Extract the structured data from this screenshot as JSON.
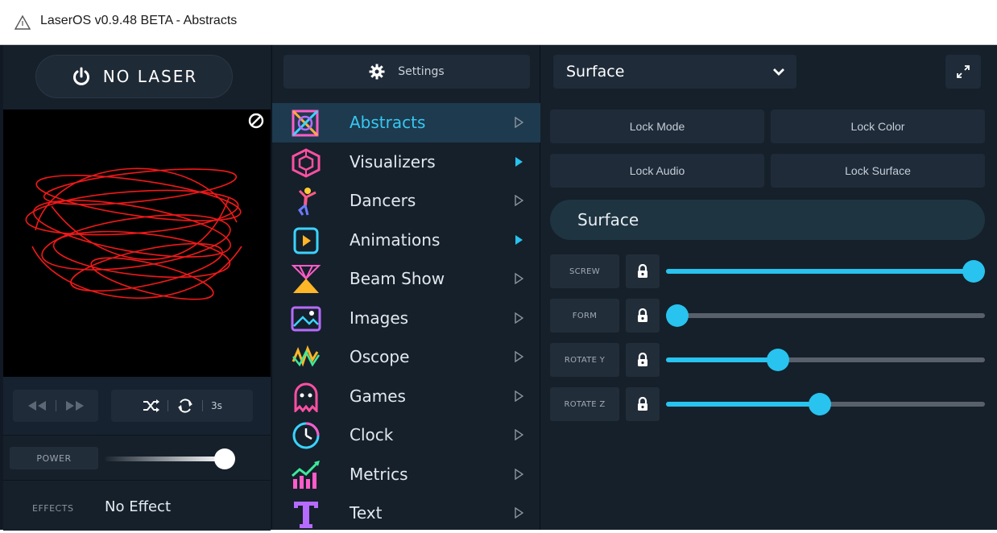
{
  "window": {
    "title": "LaserOS v0.9.48 BETA - Abstracts"
  },
  "left": {
    "no_laser_label": "NO LASER",
    "transport": {
      "interval": "3s"
    },
    "power": {
      "label": "POWER",
      "value": 1.0
    },
    "effects": {
      "label": "EFFECTS",
      "value": "No Effect"
    }
  },
  "middle": {
    "settings_label": "Settings",
    "items": [
      {
        "label": "Abstracts",
        "icon": "abstracts-icon",
        "active": true,
        "chevron": "outline"
      },
      {
        "label": "Visualizers",
        "icon": "visualizers-icon",
        "active": false,
        "chevron": "filled"
      },
      {
        "label": "Dancers",
        "icon": "dancers-icon",
        "active": false,
        "chevron": "outline"
      },
      {
        "label": "Animations",
        "icon": "animations-icon",
        "active": false,
        "chevron": "filled"
      },
      {
        "label": "Beam Show",
        "icon": "beam-show-icon",
        "active": false,
        "chevron": "outline"
      },
      {
        "label": "Images",
        "icon": "images-icon",
        "active": false,
        "chevron": "outline"
      },
      {
        "label": "Oscope",
        "icon": "oscope-icon",
        "active": false,
        "chevron": "outline"
      },
      {
        "label": "Games",
        "icon": "games-icon",
        "active": false,
        "chevron": "outline"
      },
      {
        "label": "Clock",
        "icon": "clock-icon",
        "active": false,
        "chevron": "outline"
      },
      {
        "label": "Metrics",
        "icon": "metrics-icon",
        "active": false,
        "chevron": "outline"
      },
      {
        "label": "Text",
        "icon": "text-icon",
        "active": false,
        "chevron": "outline"
      }
    ]
  },
  "right": {
    "mode_select": "Surface",
    "locks": {
      "mode": "Lock Mode",
      "color": "Lock Color",
      "audio": "Lock Audio",
      "surface": "Lock Surface"
    },
    "section_title": "Surface",
    "sliders": [
      {
        "label": "SCREW",
        "value": 1.0
      },
      {
        "label": "FORM",
        "value": 0.0
      },
      {
        "label": "ROTATE Y",
        "value": 0.34
      },
      {
        "label": "ROTATE Z",
        "value": 0.48
      }
    ]
  },
  "colors": {
    "accent": "#28c3ee",
    "active_label": "#36c8f2",
    "panel": "#15202b",
    "button": "#1f2b39",
    "laser": "#ff1a1a"
  }
}
